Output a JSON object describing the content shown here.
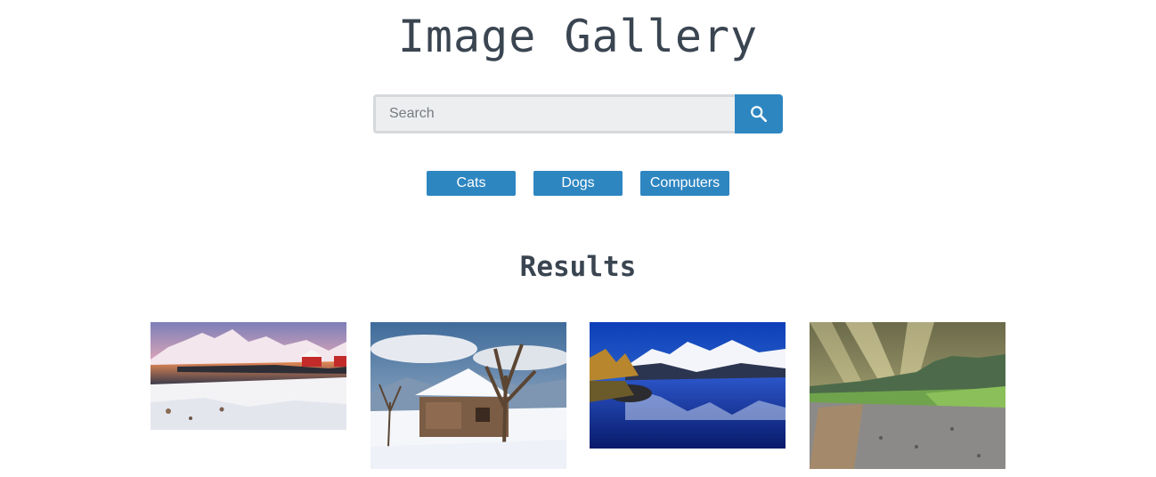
{
  "header": {
    "title": "Image Gallery"
  },
  "search": {
    "placeholder": "Search",
    "value": "",
    "button_icon": "search-icon"
  },
  "categories": [
    "Cats",
    "Dogs",
    "Computers"
  ],
  "results": {
    "title": "Results",
    "images": [
      {
        "name": "snowy-lake-cabin-sunset"
      },
      {
        "name": "snow-covered-wooden-cabin"
      },
      {
        "name": "mountain-lake-reflection"
      },
      {
        "name": "sunrays-over-mountain-path"
      }
    ]
  },
  "colors": {
    "accent": "#2e86c1",
    "heading": "#3a4551",
    "input_bg": "#eceef0"
  }
}
